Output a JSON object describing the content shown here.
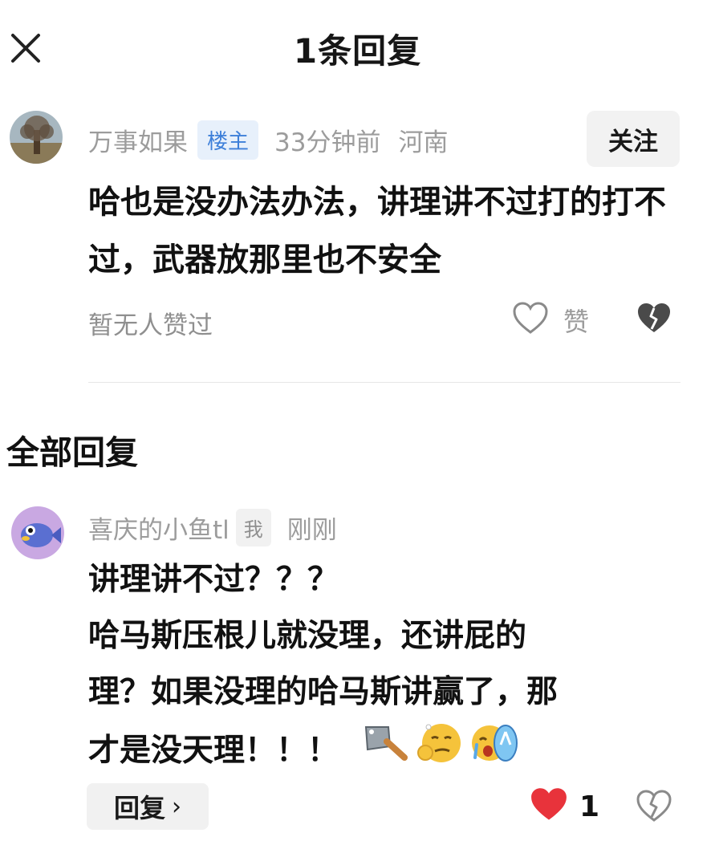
{
  "header": {
    "title": "1条回复"
  },
  "main_comment": {
    "username": "万事如果",
    "badge": "楼主",
    "time": "33分钟前",
    "location": "河南",
    "follow_label": "关注",
    "text": "哈也是没办法办法，讲理讲不过打的打不过，武器放那里也不安全",
    "likes_status": "暂无人赞过",
    "like_label": "赞",
    "icons": {
      "like": "heart-outline-icon",
      "dislike": "broken-heart-icon"
    }
  },
  "section": {
    "title": "全部回复"
  },
  "reply": {
    "username": "喜庆的小鱼tl",
    "badge": "我",
    "time": "刚刚",
    "lines": [
      "讲理讲不过？？？",
      "哈马斯压根儿就没理，还讲屁的",
      "理？如果没理的哈马斯讲赢了，那",
      "才是没天理！！！"
    ],
    "emojis": [
      "cleaver-emoji-icon",
      "smirk-emoji-icon",
      "crying-flipflop-emoji-icon"
    ],
    "reply_button_label": "回复",
    "like_count": "1",
    "colors": {
      "liked": "#e8333b"
    }
  }
}
